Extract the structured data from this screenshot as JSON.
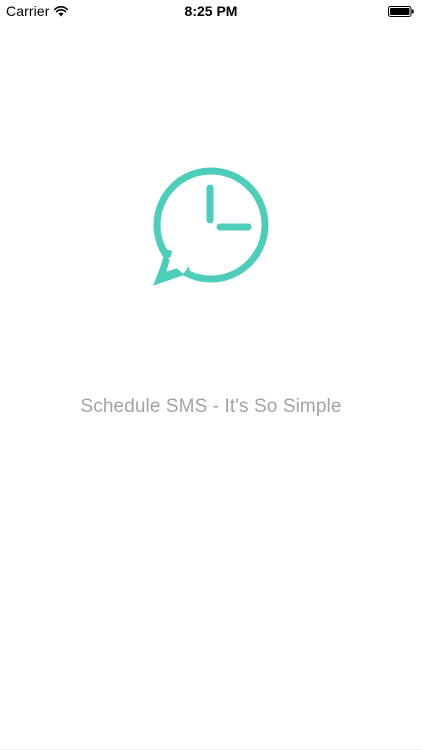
{
  "status_bar": {
    "carrier": "Carrier",
    "time": "8:25 PM",
    "icons": [
      "wifi-icon",
      "battery-icon"
    ]
  },
  "splash": {
    "logo_icon": "speech-bubble-clock-icon",
    "tagline": "Schedule SMS - It's So Simple"
  },
  "colors": {
    "accent": "#4ecdbb",
    "tagline": "#a3a3a3",
    "background": "#ffffff"
  }
}
